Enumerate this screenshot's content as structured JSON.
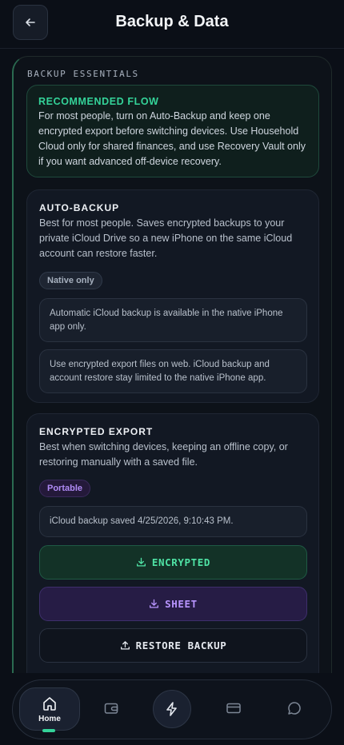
{
  "header": {
    "title": "Backup & Data",
    "back_icon": "arrow-left-icon"
  },
  "section": {
    "label": "BACKUP ESSENTIALS"
  },
  "recommended": {
    "title": "RECOMMENDED FLOW",
    "body": "For most people, turn on Auto-Backup and keep one encrypted export before switching devices. Use Household Cloud only for shared finances, and use Recovery Vault only if you want advanced off-device recovery."
  },
  "auto_backup": {
    "title": "AUTO-BACKUP",
    "description": "Best for most people. Saves encrypted backups to your private iCloud Drive so a new iPhone on the same iCloud account can restore faster.",
    "badge": "Native only",
    "notes": [
      "Automatic iCloud backup is available in the native iPhone app only.",
      "Use encrypted export files on web. iCloud backup and account restore stay limited to the native iPhone app."
    ]
  },
  "encrypted_export": {
    "title": "ENCRYPTED EXPORT",
    "description": "Best when switching devices, keeping an offline copy, or restoring manually with a saved file.",
    "badge": "Portable",
    "status": "iCloud backup saved 4/25/2026, 9:10:43 PM.",
    "buttons": {
      "encrypted": "ENCRYPTED",
      "sheet": "SHEET",
      "restore": "RESTORE BACKUP"
    }
  },
  "nav": {
    "home_label": "Home",
    "items": [
      "home-icon",
      "wallet-icon",
      "bolt-icon",
      "card-icon",
      "chat-icon"
    ]
  },
  "colors": {
    "accent_green": "#34d399",
    "accent_purple": "#b895ff",
    "background": "#0b0f17"
  }
}
